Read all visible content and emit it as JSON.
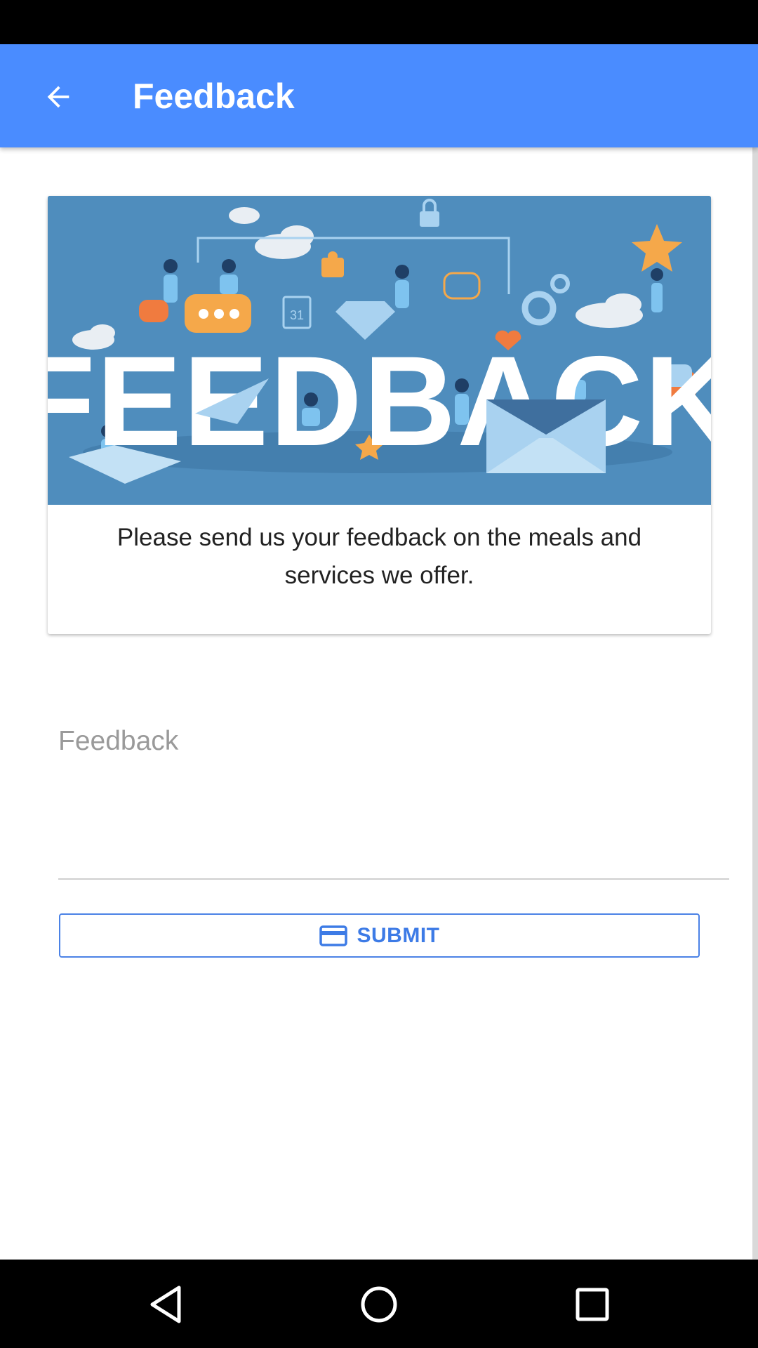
{
  "app_bar": {
    "title": "Feedback",
    "back_icon": "arrow-back-icon",
    "color": "#4a8cff"
  },
  "card": {
    "image_text": "FEEDBACK",
    "calendar_day": "31",
    "message": "Please send us your feedback on the meals and services we offer."
  },
  "form": {
    "feedback_label": "Feedback",
    "feedback_value": "",
    "submit_label": "SUBMIT",
    "submit_icon": "credit-card-icon",
    "accent_color": "#3d7be6"
  },
  "nav": {
    "back_icon": "nav-back-triangle-icon",
    "home_icon": "nav-home-circle-icon",
    "recents_icon": "nav-recents-square-icon"
  }
}
